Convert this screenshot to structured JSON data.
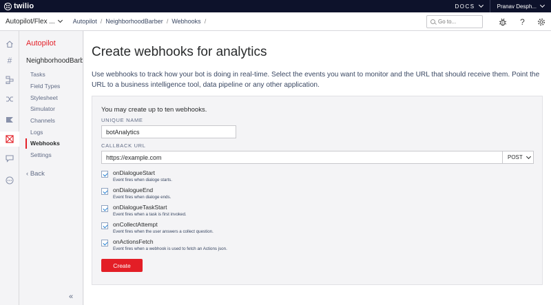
{
  "topbar": {
    "logo_text": "twilio",
    "docs_label": "DOCS",
    "user_name": "Pranav Desph..."
  },
  "crumbbar": {
    "project_name": "Autopilot/Flex ...",
    "crumbs": [
      "Autopilot",
      "NeighborhoodBarber",
      "Webhooks"
    ],
    "search_placeholder": "Go to..."
  },
  "rail": {
    "icons": [
      "home-icon",
      "hash-icon",
      "flow-icon",
      "shuffle-icon",
      "flag-icon",
      "autopilot-icon",
      "chat-icon",
      "more-icon"
    ],
    "active": "autopilot-icon"
  },
  "sidebar": {
    "title": "Autopilot",
    "assistant": "NeighborhoodBarber",
    "items": [
      {
        "label": "Tasks"
      },
      {
        "label": "Field Types"
      },
      {
        "label": "Stylesheet"
      },
      {
        "label": "Simulator"
      },
      {
        "label": "Channels"
      },
      {
        "label": "Logs"
      },
      {
        "label": "Webhooks"
      },
      {
        "label": "Settings"
      }
    ],
    "active_item": "Webhooks",
    "back_label": "Back",
    "collapse_glyph": "«"
  },
  "main": {
    "title": "Create webhooks for analytics",
    "description": "Use webhooks to track how your bot is doing in real-time. Select the events you want to monitor and the URL that should receive them. Point the URL to a business intelligence tool, data pipeline or any other application.",
    "card_note": "You may create up to ten webhooks.",
    "unique_name_label": "UNIQUE NAME",
    "unique_name_value": "botAnalytics",
    "callback_url_label": "CALLBACK URL",
    "callback_url_value": "https://example.com",
    "method": "POST",
    "events": [
      {
        "name": "onDialogueStart",
        "desc": "Event fires when dialoge starts.",
        "checked": true
      },
      {
        "name": "onDialogueEnd",
        "desc": "Event fires when dialoge ends.",
        "checked": true
      },
      {
        "name": "onDialogueTaskStart",
        "desc": "Event fires when a task is first invoked.",
        "checked": true
      },
      {
        "name": "onCollectAttempt",
        "desc": "Event fires when the user answers a collect question.",
        "checked": true
      },
      {
        "name": "onActionsFetch",
        "desc": "Event fires when a webhook is used to fetch an Actions json.",
        "checked": true
      }
    ],
    "create_label": "Create"
  },
  "colors": {
    "brand_red": "#e31e26",
    "topbar_navy": "#0d122b"
  }
}
